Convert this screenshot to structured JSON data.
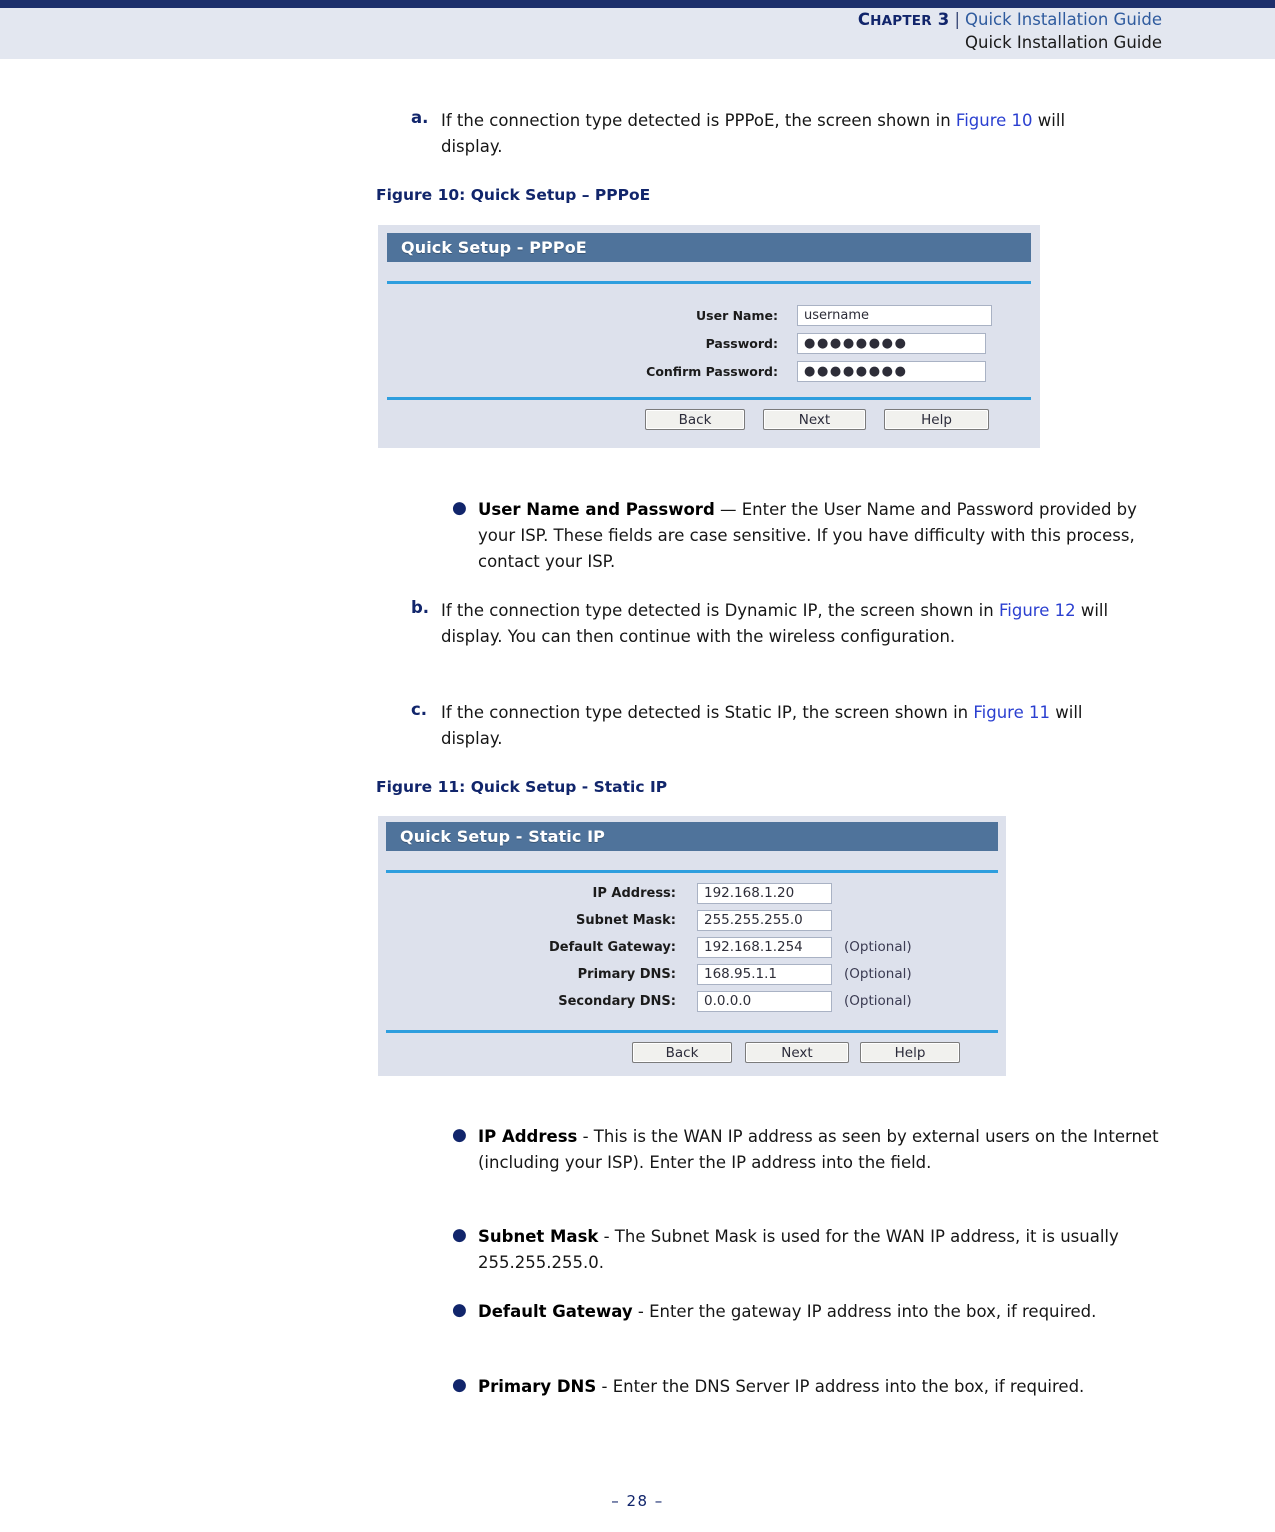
{
  "header": {
    "chapter_label": "Chapter 3",
    "chapter_label_caps_head": "C",
    "chapter_label_caps_rest": "HAPTER",
    "chapter_number": "3",
    "separator": "|",
    "guide_title": "Quick Installation Guide",
    "running_title": "Quick Installation Guide",
    "rule_color": "#1c2f6b",
    "band_color": "#e3e7f0"
  },
  "steps": {
    "a": {
      "marker": "a.",
      "text_1": "If the connection type detected is PPPoE, the screen shown in ",
      "figref": "Figure 10",
      "text_2": " will display."
    },
    "b": {
      "marker": "b.",
      "text_1": "If the connection type detected is Dynamic IP, the screen shown in ",
      "figref": "Figure 12",
      "text_2": " will display. You can then continue with the wireless configuration."
    },
    "c": {
      "marker": "c.",
      "text_1": "If the connection type detected is Static IP, the screen shown in ",
      "figref": "Figure 11",
      "text_2": " will display."
    }
  },
  "figure10": {
    "caption": "Figure 10:  Quick Setup – PPPoE",
    "panel_title": "Quick Setup - PPPoE",
    "fields": [
      {
        "label": "User Name:",
        "value": "username",
        "masked": false,
        "optional": ""
      },
      {
        "label": "Password:",
        "value": "●●●●●●●●",
        "masked": true,
        "optional": ""
      },
      {
        "label": "Confirm Password:",
        "value": "●●●●●●●●",
        "masked": true,
        "optional": ""
      }
    ],
    "buttons": [
      "Back",
      "Next",
      "Help"
    ]
  },
  "figure11": {
    "caption": "Figure 11:  Quick Setup - Static IP",
    "panel_title": "Quick Setup - Static IP",
    "fields": [
      {
        "label": "IP Address:",
        "value": "192.168.1.20",
        "optional": ""
      },
      {
        "label": "Subnet Mask:",
        "value": "255.255.255.0",
        "optional": ""
      },
      {
        "label": "Default Gateway:",
        "value": "192.168.1.254",
        "optional": "(Optional)"
      },
      {
        "label": "Primary DNS:",
        "value": "168.95.1.1",
        "optional": "(Optional)"
      },
      {
        "label": "Secondary DNS:",
        "value": "0.0.0.0",
        "optional": "(Optional)"
      }
    ],
    "buttons": [
      "Back",
      "Next",
      "Help"
    ]
  },
  "bullets": {
    "user_name_password": {
      "term": "User Name and Password",
      "body": " — Enter the User Name and Password provided by your ISP. These fields are case sensitive. If you have difficulty with this process, contact your ISP."
    },
    "ip_address": {
      "term": "IP Address",
      "body": " - This is the WAN IP address as seen by external users on the Internet (including your ISP). Enter the IP address into the field."
    },
    "subnet_mask": {
      "term": "Subnet Mask",
      "body": " - The Subnet Mask is used for the WAN IP address, it is usually 255.255.255.0."
    },
    "default_gateway": {
      "term": "Default Gateway",
      "body": " - Enter the gateway IP address into the box, if required."
    },
    "primary_dns": {
      "term": "Primary DNS",
      "body": " - Enter the DNS Server IP address into the box, if required."
    }
  },
  "footer": {
    "page_marker": "–  28  –"
  }
}
